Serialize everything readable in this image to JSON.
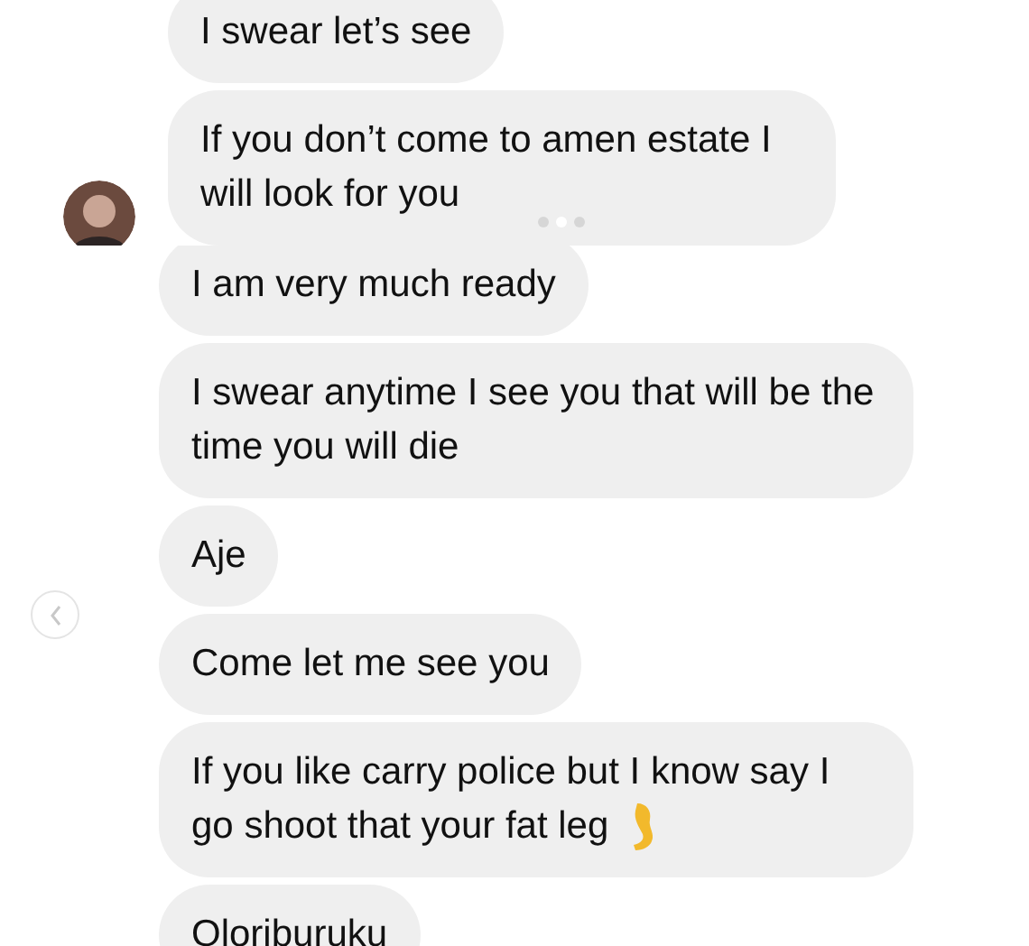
{
  "sections": [
    {
      "messages": [
        {
          "text": "I swear let’s see",
          "avatar": false
        },
        {
          "text": "If you don’t come to amen estate I will look for you",
          "avatar": true
        }
      ],
      "carousel_dots": [
        {
          "selected": false
        },
        {
          "selected": true
        },
        {
          "selected": false
        }
      ]
    },
    {
      "messages": [
        {
          "text": "I am very much ready",
          "kind": "text"
        },
        {
          "text": "I swear anytime I see you that will be the time you will die",
          "kind": "text"
        },
        {
          "text": "Aje",
          "kind": "text"
        },
        {
          "text": "Come let me see you",
          "kind": "text"
        },
        {
          "text": "If you like carry police but I know say I go shoot that your fat leg",
          "kind": "text_with_leg_emoji"
        },
        {
          "text": "Oloriburuku",
          "kind": "text"
        }
      ]
    }
  ]
}
